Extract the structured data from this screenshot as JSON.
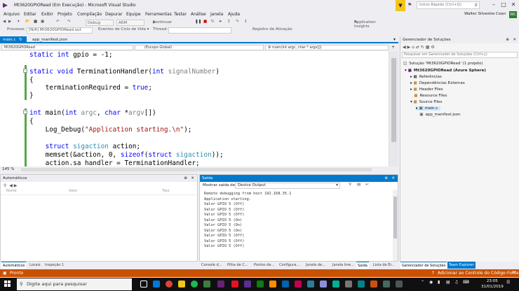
{
  "window": {
    "title": "Mt3620GPIORead (Em Execução) - Microsoft Visual Studio",
    "quick_launch_placeholder": "Início Rápido (Ctrl+Q)",
    "user": "Walter Silvestre Coan",
    "user_initials": "WC"
  },
  "menu": [
    "Arquivo",
    "Editar",
    "Exibir",
    "Projeto",
    "Compilação",
    "Depurar",
    "Equipe",
    "Ferramentas",
    "Testar",
    "Análise",
    "Janela",
    "Ajuda"
  ],
  "toolbar": {
    "config": "Debug",
    "platform": "ARM",
    "continue": "Continuar",
    "insights": "Application Insights"
  },
  "debugbar": {
    "process_label": "Processo:",
    "process_value": "[N/A] Mt3620GPIORead.out",
    "lifecycle": "Eventos de Ciclo de Vida",
    "thread_label": "Thread:",
    "stack_label": "Registro de Ativação"
  },
  "editor": {
    "tabs": [
      {
        "label": "main.c",
        "active": true
      },
      {
        "label": "app_manifest.json",
        "active": false
      }
    ],
    "nav_project": "Mt3620GPIORead",
    "nav_scope": "(Escopo Global)",
    "nav_func": "main(int argc, char * argv[])",
    "zoom": "145 %"
  },
  "solution": {
    "header": "Gerenciador de Soluções",
    "search_placeholder": "Pesquisar em Gerenciador de Soluções (Ctrl+ç)",
    "nodes": [
      {
        "label": "Solução 'Mt3620GPIORead' (1 projeto)",
        "icon": "solution-icon"
      },
      {
        "label": "Mt3620GPIORead (Azure Sphere)",
        "icon": "project-icon"
      },
      {
        "label": "Referências",
        "icon": "references-icon"
      },
      {
        "label": "Dependências Externas",
        "icon": "folder-icon"
      },
      {
        "label": "Header Files",
        "icon": "folder-icon"
      },
      {
        "label": "Resource Files",
        "icon": "folder-icon"
      },
      {
        "label": "Source Files",
        "icon": "folder-icon"
      },
      {
        "label": "main.c",
        "icon": "c-file-icon"
      },
      {
        "label": "app_manifest.json",
        "icon": "json-file-icon"
      }
    ]
  },
  "autos": {
    "header": "Automáticos",
    "cols": [
      "Nome",
      "Valor",
      "Tipo"
    ]
  },
  "output": {
    "header": "Saída",
    "show_label": "Mostrar saída de:",
    "source": "Device Output",
    "lines": [
      "Remote debugging from host 192.168.35.1",
      "Application starting.",
      "Valor GPIO 5 (Off)",
      "Valor GPIO 5 (Off)",
      "Valor GPIO 5 (Off)",
      "Valor GPIO 5 (On)",
      "Valor GPIO 5 (On)",
      "Valor GPIO 5 (On)",
      "Valor GPIO 5 (Off)",
      "Valor GPIO 5 (Off)",
      "Valor GPIO 5 (Off)"
    ]
  },
  "bottom_tabs_left": [
    {
      "label": "Automáticos",
      "on": true
    },
    {
      "label": "Locais",
      "on": false
    },
    {
      "label": "Inspeção 1",
      "on": false
    }
  ],
  "bottom_tabs_right": [
    {
      "label": "Console d...",
      "on": false
    },
    {
      "label": "Pilha de C...",
      "on": false
    },
    {
      "label": "Pontos de...",
      "on": false
    },
    {
      "label": "Configura...",
      "on": false
    },
    {
      "label": "Janela de...",
      "on": false
    },
    {
      "label": "Janela Ime...",
      "on": false
    },
    {
      "label": "Saída",
      "on": true
    },
    {
      "label": "Lista de Er...",
      "on": false
    }
  ],
  "bottom_tabs_sol": [
    {
      "label": "Gerenciador de Soluções",
      "on": true
    },
    {
      "label": "Team Explorer",
      "on": false
    }
  ],
  "status": {
    "left": "Pronto",
    "right": "Adicionar ao Controle do Código-Fonte"
  },
  "taskbar": {
    "search_placeholder": "Digite aqui para pesquisar",
    "time": "23:05",
    "date": "31/01/2019"
  }
}
